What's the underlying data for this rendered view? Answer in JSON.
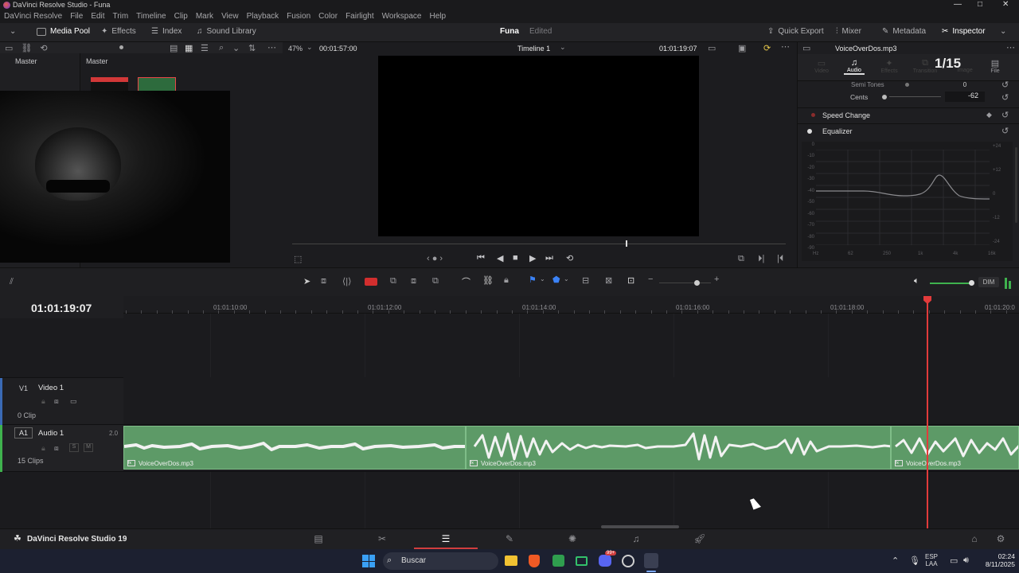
{
  "window": {
    "title": "DaVinci Resolve Studio - Funa",
    "controls": [
      "—",
      "□",
      "✕"
    ]
  },
  "menu": [
    "DaVinci Resolve",
    "File",
    "Edit",
    "Trim",
    "Timeline",
    "Clip",
    "Mark",
    "View",
    "Playback",
    "Fusion",
    "Color",
    "Fairlight",
    "Workspace",
    "Help"
  ],
  "toolbar": {
    "left": [
      "Media Pool",
      "Effects",
      "Index",
      "Sound Library"
    ],
    "project_name": "Funa",
    "project_status": "Edited",
    "right": [
      "Quick Export",
      "Mixer",
      "Metadata",
      "Inspector"
    ]
  },
  "media_pool": {
    "bin": "Master",
    "header": "Master"
  },
  "viewer": {
    "zoom": "47%",
    "duration": "00:01:57:00",
    "timeline_name": "Timeline 1",
    "timecode": "01:01:19:07"
  },
  "inspector": {
    "clip_name": "VoiceOverDos.mp3",
    "tabs": [
      "Video",
      "Audio",
      "Effects",
      "Transition",
      "Image",
      "File"
    ],
    "active_tab": "Audio",
    "counter": "1/15",
    "semi_tones_label": "Semi Tones",
    "semi_tones_value": "0",
    "cents_label": "Cents",
    "cents_value": "-62",
    "speed_change_label": "Speed Change",
    "equalizer_label": "Equalizer",
    "eq_left_axis": [
      "0",
      "-10",
      "-20",
      "-30",
      "-40",
      "-50",
      "-60",
      "-70",
      "-80",
      "-90"
    ],
    "eq_right_axis": [
      "+24",
      "+12",
      "0",
      "-12",
      "-24"
    ],
    "eq_bottom_axis": [
      "Hz",
      "62",
      "250",
      "1k",
      "4k",
      "16k"
    ]
  },
  "timeline": {
    "timecode": "01:01:19:07",
    "ruler": [
      "01:01:10:00",
      "01:01:12:00",
      "01:01:14:00",
      "01:01:16:00",
      "01:01:18:00",
      "01:01:20:0"
    ],
    "tracks": {
      "video": {
        "id": "V1",
        "name": "Video 1",
        "clips": "0 Clip"
      },
      "audio": {
        "id": "A1",
        "name": "Audio 1",
        "level": "2.0",
        "clips": "15 Clips",
        "s": "S",
        "m": "M"
      }
    },
    "clip_names": [
      "VoiceOverDos.mp3",
      "VoiceOverDos.mp3",
      "VoiceOverDos.mp3"
    ],
    "dim_label": "DIM"
  },
  "pagebar": {
    "app_name": "DaVinci Resolve Studio 19"
  },
  "taskbar": {
    "search_placeholder": "Buscar",
    "lang_line1": "ESP",
    "lang_line2": "LAA",
    "time": "02:24",
    "date": "8/11/2025",
    "notification_badge": "99+"
  },
  "colors": {
    "audio_clip": "#5d9a67",
    "playhead": "#e23b3b",
    "accent_blue": "#3b82f6"
  }
}
